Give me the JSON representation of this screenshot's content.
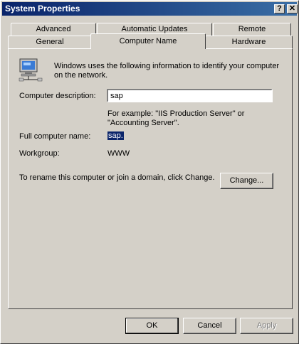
{
  "window": {
    "title": "System Properties",
    "help_glyph": "?",
    "close_glyph": "✕"
  },
  "tabs_back": [
    {
      "label": "Advanced"
    },
    {
      "label": "Automatic Updates"
    },
    {
      "label": "Remote"
    }
  ],
  "tabs_front": [
    {
      "label": "General"
    },
    {
      "label": "Computer Name",
      "active": true
    },
    {
      "label": "Hardware"
    }
  ],
  "info": {
    "icon": "computer-network-icon",
    "line1": "Windows uses the following information to identify your computer",
    "line2": "on the network."
  },
  "description": {
    "label": "Computer description:",
    "value": "sap",
    "example_line1": "For example: \"IIS Production Server\" or",
    "example_line2": "\"Accounting Server\"."
  },
  "full_name": {
    "label": "Full computer name:",
    "value": "sap."
  },
  "workgroup": {
    "label": "Workgroup:",
    "value": "WWW"
  },
  "rename": {
    "text": "To rename this computer or join a domain, click Change.",
    "button": "Change..."
  },
  "footer": {
    "ok": "OK",
    "cancel": "Cancel",
    "apply": "Apply"
  },
  "colors": {
    "titlebar_start": "#0a246a",
    "titlebar_end": "#3a6ea5",
    "face": "#d4d0c8",
    "selection": "#0a246a"
  }
}
